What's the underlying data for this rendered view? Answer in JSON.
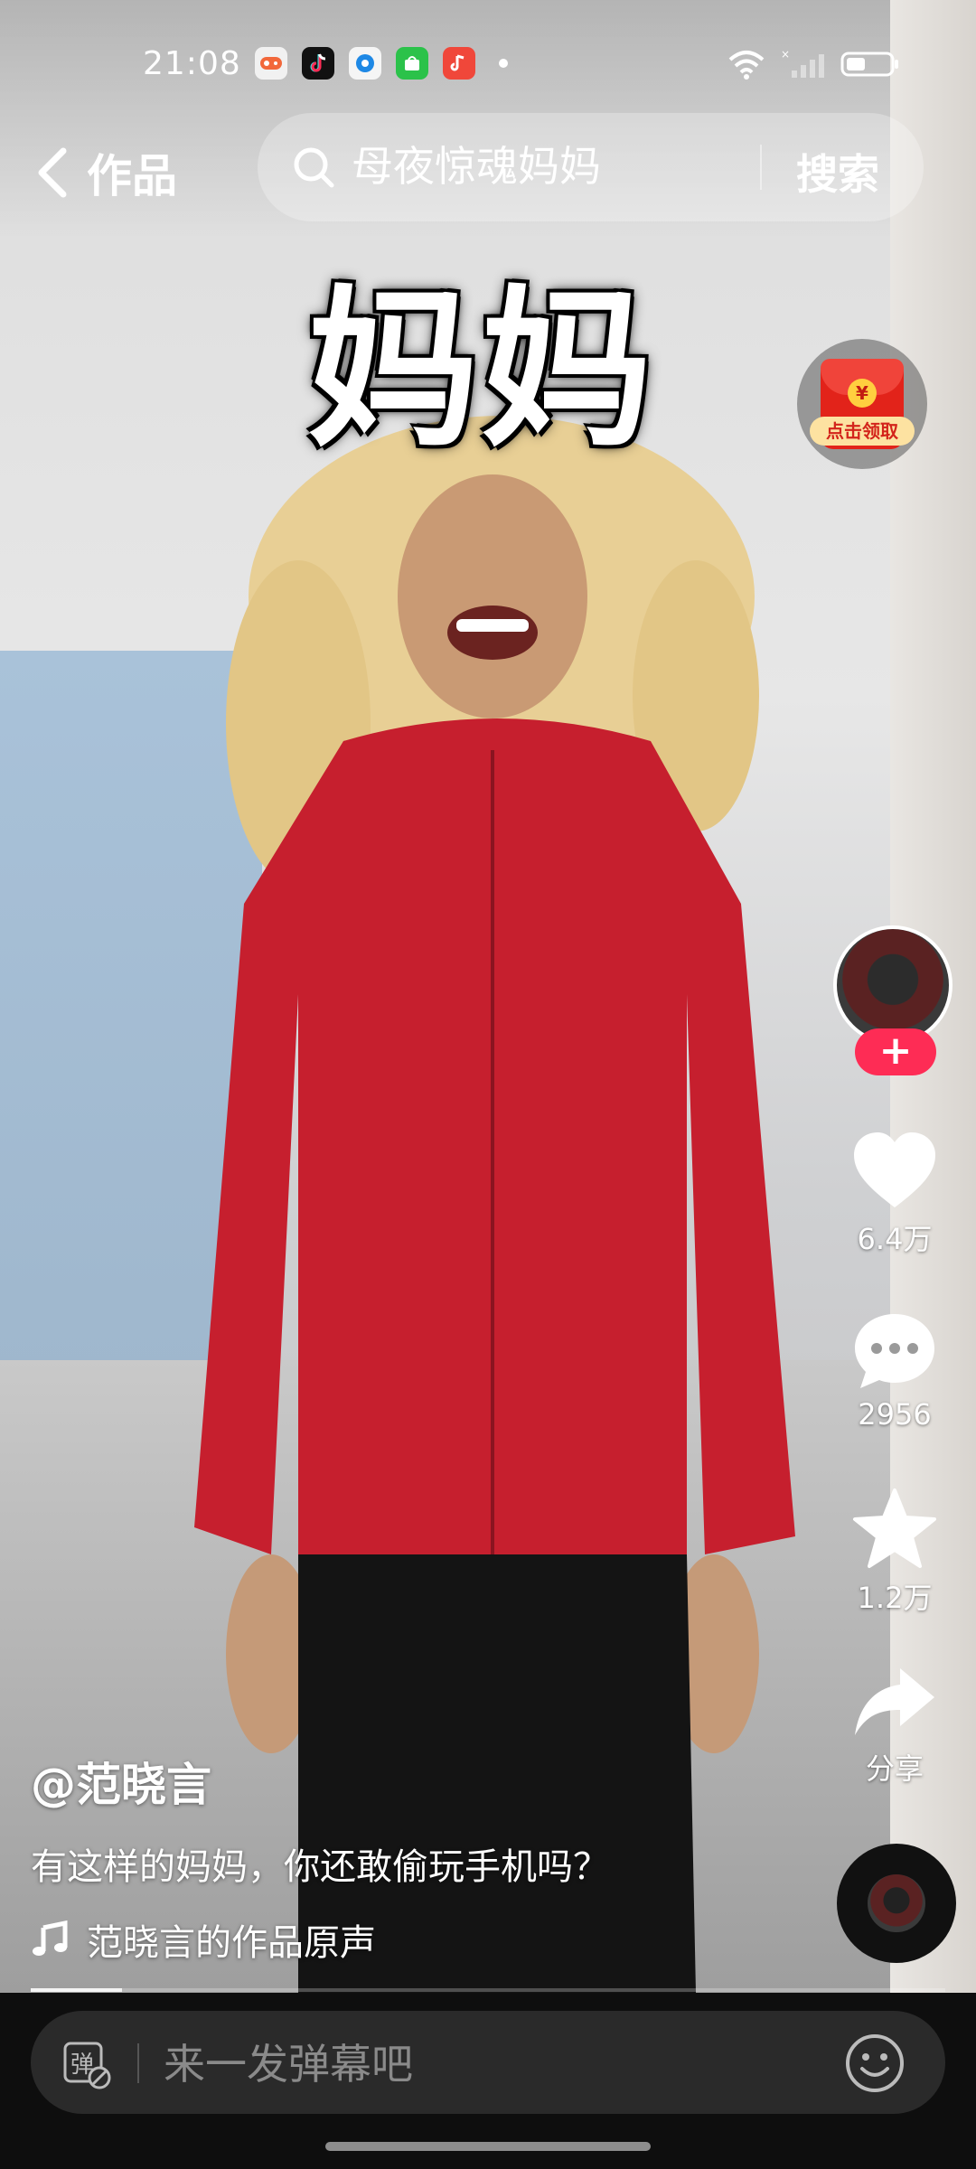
{
  "status_bar": {
    "time": "21:08",
    "notification_icons": [
      "game-app-icon",
      "tiktok-icon",
      "browser-icon",
      "store-icon",
      "music-app-icon"
    ],
    "system_icons": [
      "wifi-icon",
      "signal-icon",
      "battery-icon"
    ]
  },
  "topbar": {
    "back_label": "作品",
    "search_placeholder": "母夜惊魂妈妈",
    "search_button": "搜索"
  },
  "video": {
    "caption": "妈妈",
    "progress": 0.1
  },
  "red_packet": {
    "label": "点击领取",
    "coin": "¥"
  },
  "actions": {
    "follow": "+",
    "like_count": "6.4万",
    "comment_count": "2956",
    "favorite_count": "1.2万",
    "share_label": "分享"
  },
  "info": {
    "author": "@范晓言",
    "description": "有这样的妈妈，你还敢偷玩手机吗？",
    "music": "范晓言的作品原声"
  },
  "bottombar": {
    "danmu_placeholder": "来一发弹幕吧",
    "danmu_icon_label": "弹"
  },
  "colors": {
    "accent": "#fe2c55",
    "bottom_bar": "#0e0e0e",
    "red_packet": "#e2231a"
  }
}
